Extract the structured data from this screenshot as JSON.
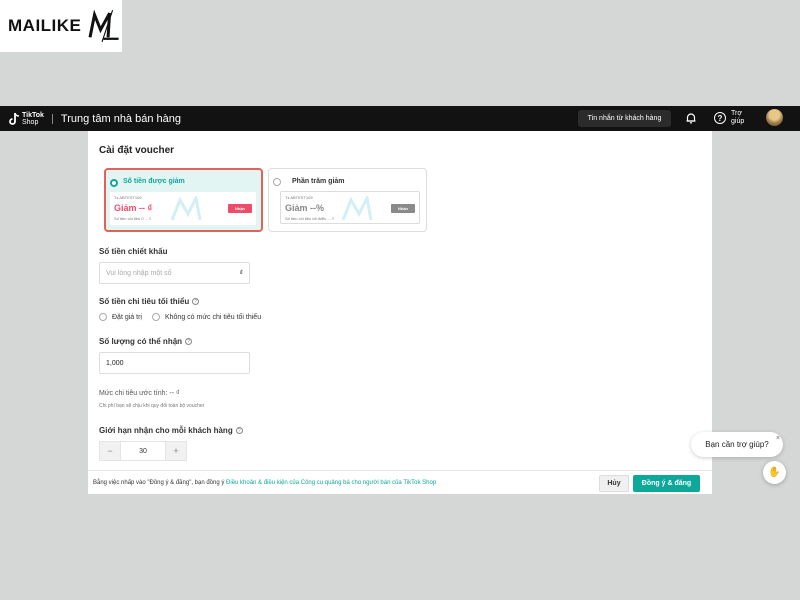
{
  "branding": {
    "watermark_text": "MAILIKE",
    "watermark_mark": "ML"
  },
  "topbar": {
    "brand_line1": "TikTok",
    "brand_line2": "Shop",
    "title": "Trung tâm nhà bán hàng",
    "messages_label": "Tin nhắn từ khách hàng",
    "help_label": "Trợ giúp",
    "bell_icon": "bell-icon",
    "help_icon": "question-circle-icon"
  },
  "voucher": {
    "section_title": "Cài đặt voucher",
    "options": [
      {
        "label": "Số tiền được giảm",
        "selected": true,
        "code": "Tz ABTEST109",
        "amount": "Giảm -- ₫",
        "min_spend": "Số tiền chi tiêu 0 ... ₫",
        "claim_label": "Nhận"
      },
      {
        "label": "Phần trăm giảm",
        "selected": false,
        "code": "Tz ABTEST109",
        "amount": "Giảm --%",
        "min_spend": "Số tiền chi tiêu tối thiểu ... ₫",
        "claim_label": "Nhận"
      }
    ]
  },
  "discount": {
    "label": "Số tiền chiết khấu",
    "placeholder": "Vui lòng nhập một số",
    "suffix": "₫"
  },
  "min_spend": {
    "label": "Số tiền chi tiêu tối thiểu",
    "options": [
      "Đặt giá trị",
      "Không có mức chi tiêu tối thiểu"
    ]
  },
  "quantity": {
    "label": "Số lượng có thể nhận",
    "value": "1,000"
  },
  "estimate": {
    "label": "Mức chi tiêu ước tính: -- ₫",
    "note": "Chi phí bạn sẽ chịu khi quy đổi toàn bộ voucher"
  },
  "limit": {
    "label": "Giới hạn nhận cho mỗi khách hàng",
    "minus": "−",
    "value": "30",
    "plus": "+"
  },
  "footer": {
    "terms_prefix": "Bằng việc nhấp vào \"Đồng ý & đăng\", bạn đồng ý",
    "terms_link": "Điều khoản & điều kiện của Công cụ quảng bá cho người bán của TikTok Shop",
    "cancel_label": "Hủy",
    "accept_label": "Đồng ý & đăng"
  },
  "chat": {
    "bubble_text": "Bạn cần trợ giúp?",
    "close": "×",
    "fab_icon": "hand-wave-icon"
  },
  "colors": {
    "accent": "#0ea89b",
    "highlight_border": "#e2625a",
    "voucher_red": "#ee4d6a",
    "topbar": "#121212"
  }
}
